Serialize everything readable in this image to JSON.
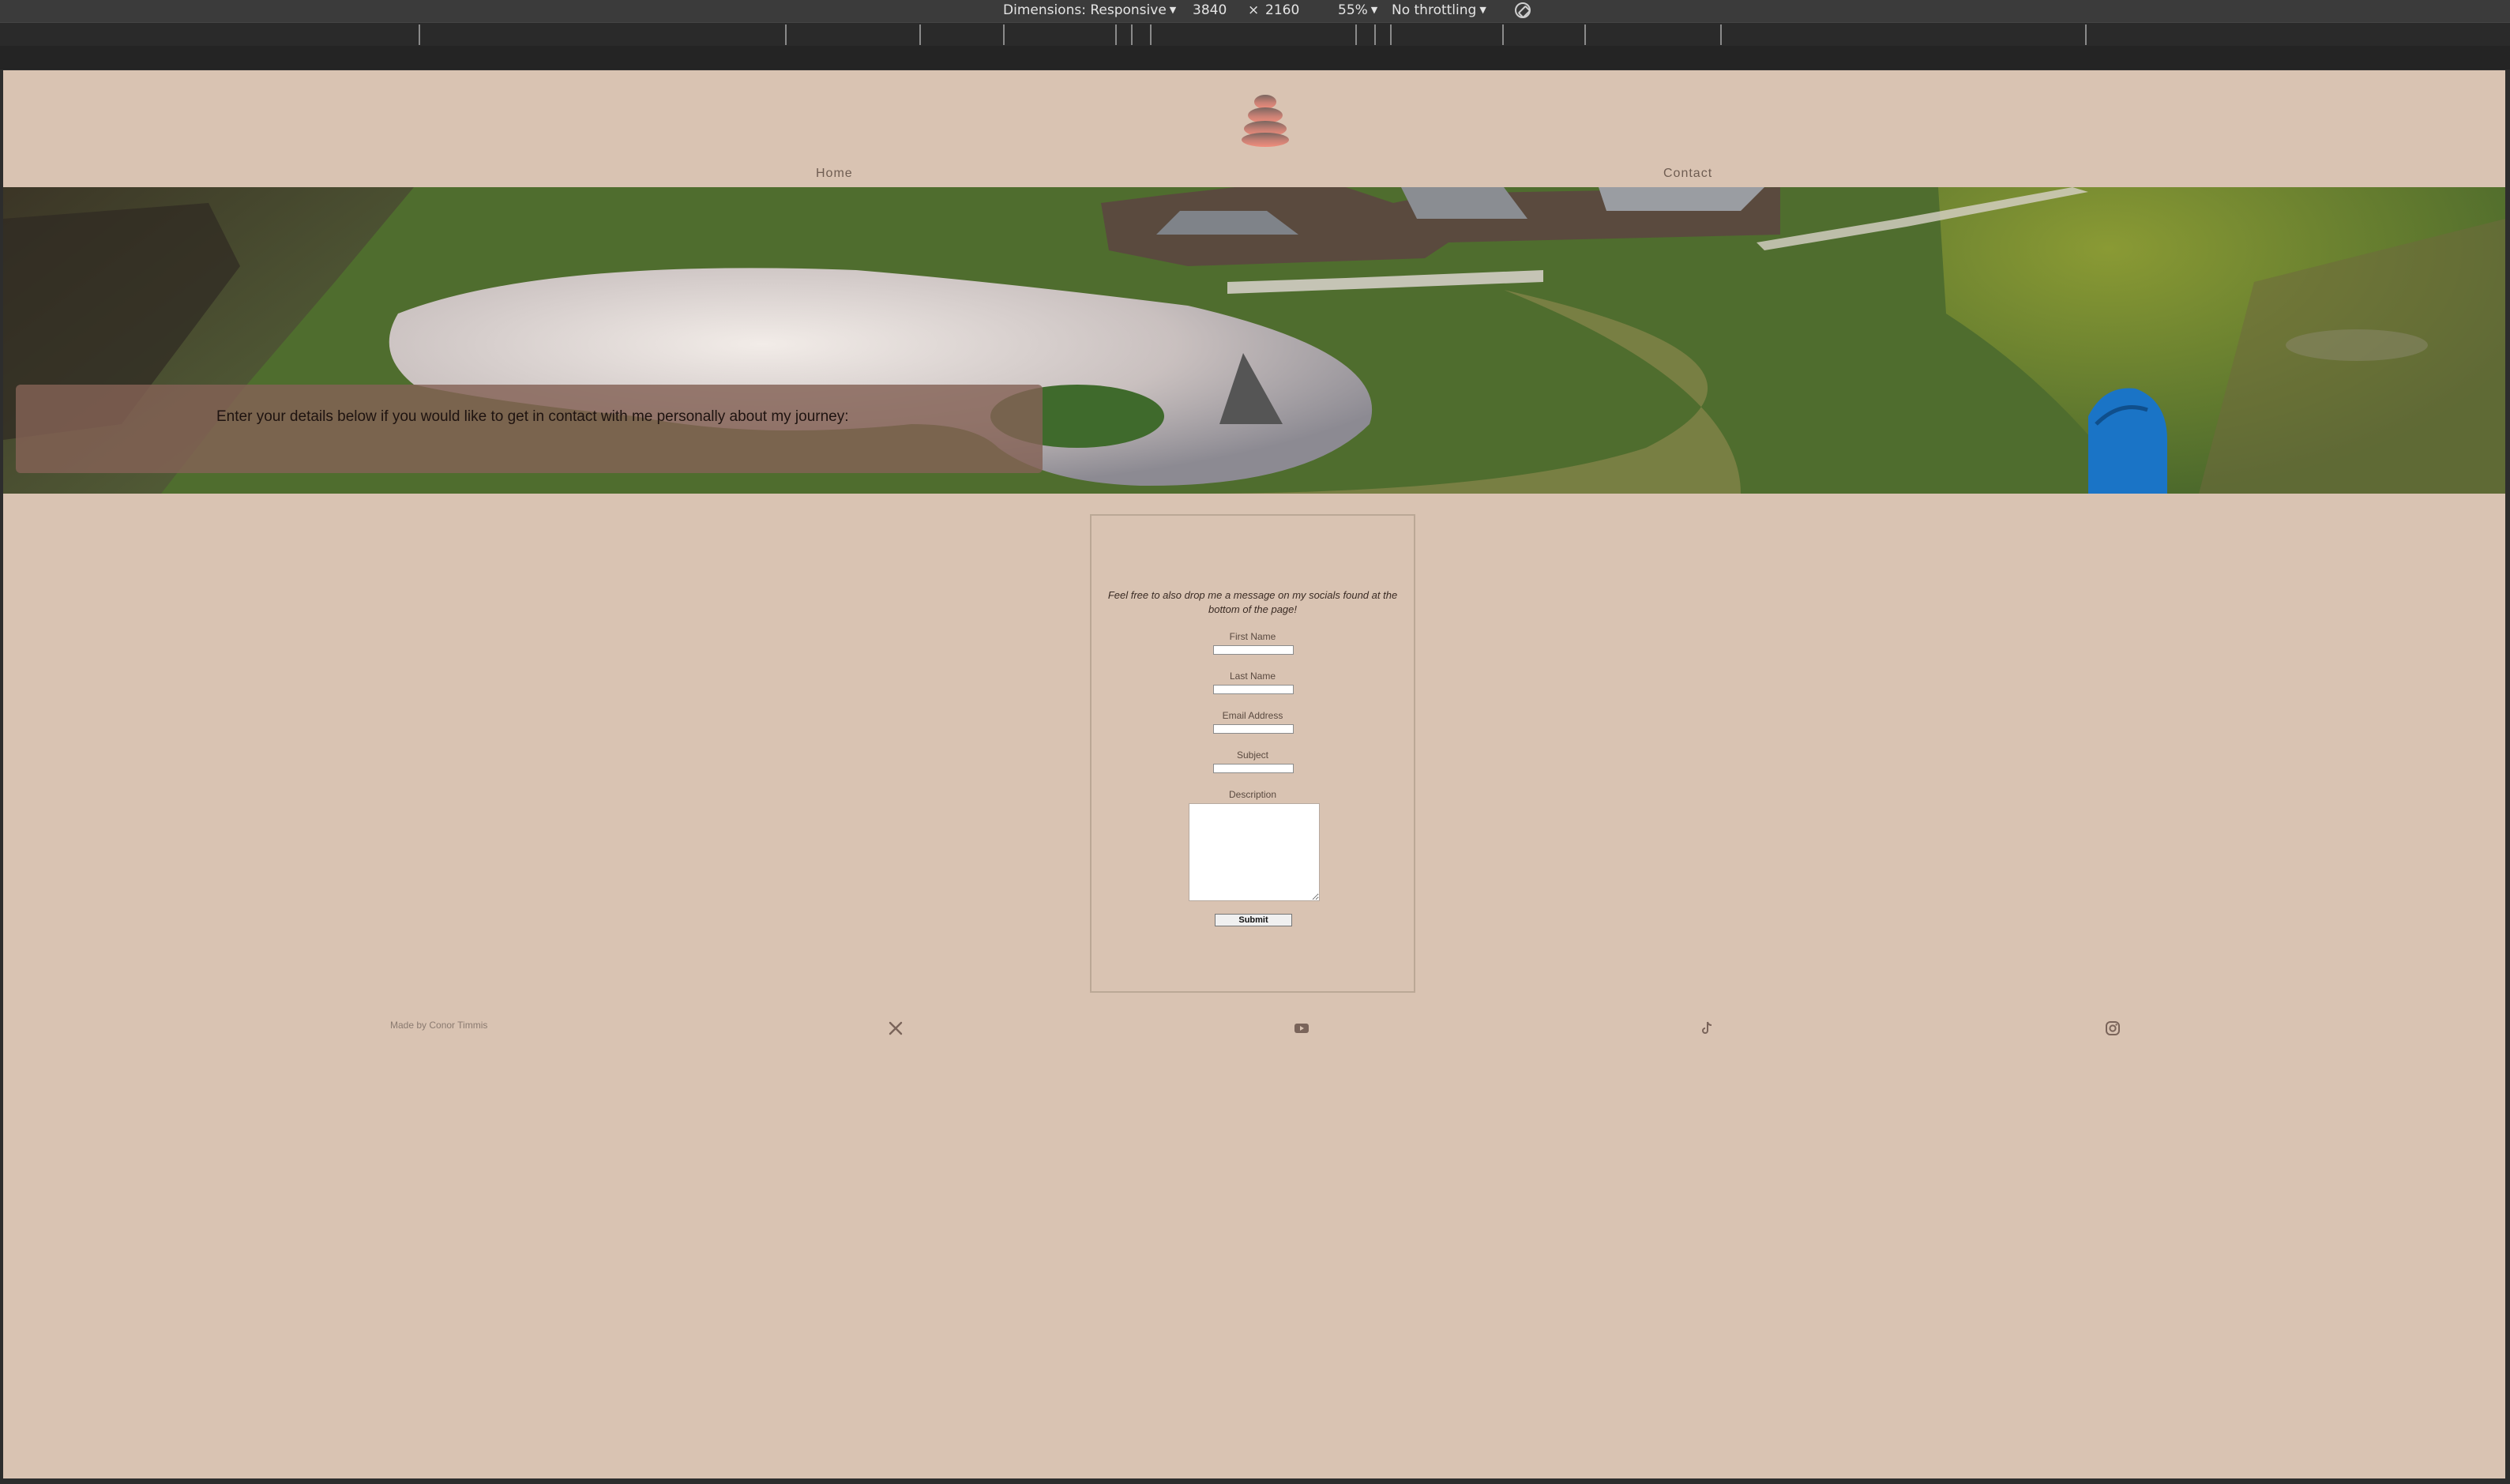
{
  "devtools": {
    "dimensions_label": "Dimensions: Responsive",
    "width": "3840",
    "times": "×",
    "height": "2160",
    "zoom": "55%",
    "throttling": "No throttling",
    "rotate_icon": "rotate-icon"
  },
  "site": {
    "logo_icon": "stacked-stones-icon",
    "nav": {
      "home": "Home",
      "contact": "Contact"
    },
    "hero": {
      "text": "Enter your details below if you would like to get in contact with me personally about my journey:"
    },
    "form": {
      "note": "Feel free to also drop me a message on my socials found at the bottom of the page!",
      "first_name_label": "First Name",
      "last_name_label": "Last Name",
      "email_label": "Email Address",
      "subject_label": "Subject",
      "description_label": "Description",
      "submit_label": "Submit"
    },
    "footer": {
      "credit": "Made by Conor Timmis",
      "icons": [
        "x-twitter-icon",
        "youtube-icon",
        "tiktok-icon",
        "instagram-icon"
      ]
    }
  },
  "colors": {
    "page_bg": "#d9c3b2",
    "hero_overlay": "#846256",
    "logo_top": "#7a6660",
    "logo_bottom": "#ef8a7a",
    "nav_text": "#6f5d52"
  }
}
